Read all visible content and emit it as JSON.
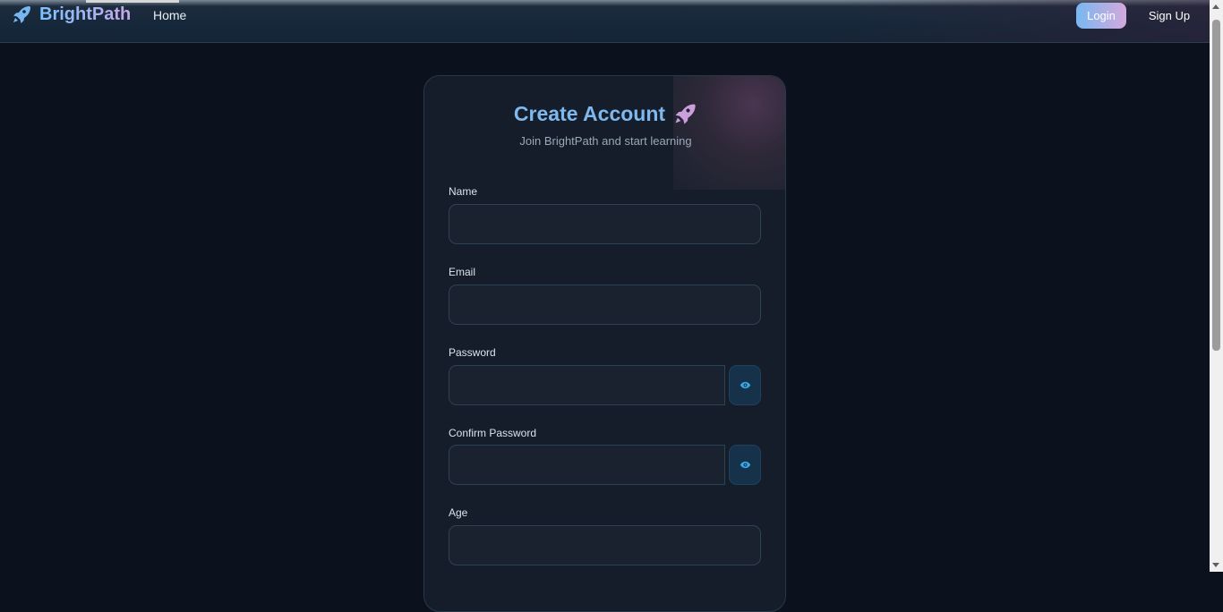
{
  "navbar": {
    "brand_name": "BrightPath",
    "home_label": "Home",
    "login_label": "Login",
    "signup_label": "Sign Up"
  },
  "form": {
    "title": "Create Account",
    "subtitle": "Join BrightPath and start learning",
    "fields": [
      {
        "label": "Name",
        "value": "",
        "type": "text"
      },
      {
        "label": "Email",
        "value": "",
        "type": "email"
      },
      {
        "label": "Password",
        "value": "",
        "type": "password",
        "toggle_icon": "eye-icon"
      },
      {
        "label": "Confirm Password",
        "value": "",
        "type": "password",
        "toggle_icon": "eye-icon"
      },
      {
        "label": "Age",
        "value": "",
        "type": "number"
      }
    ]
  },
  "colors": {
    "background": "#0c121d",
    "card": "#141d29",
    "accent_blue": "#7fb8ee",
    "accent_pink": "#d3a9dc",
    "rocket": "#c9a0dc"
  },
  "icons": {
    "brand": "rocket-icon",
    "title": "rocket-icon",
    "password_toggle": "eye-icon"
  }
}
